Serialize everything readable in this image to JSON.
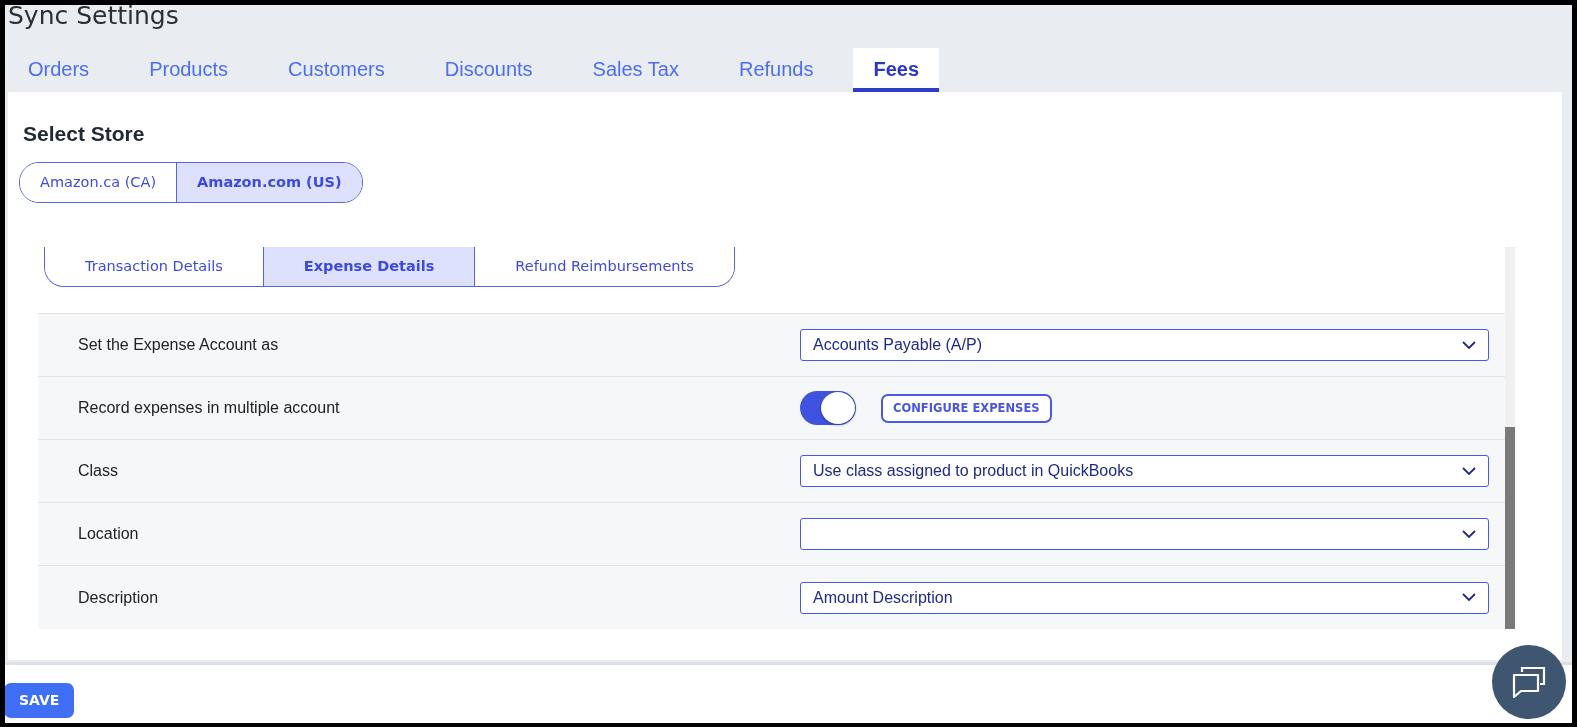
{
  "page_title": "Sync Settings",
  "tabs": [
    {
      "label": "Orders",
      "selected": false
    },
    {
      "label": "Products",
      "selected": false
    },
    {
      "label": "Customers",
      "selected": false
    },
    {
      "label": "Discounts",
      "selected": false
    },
    {
      "label": "Sales Tax",
      "selected": false
    },
    {
      "label": "Refunds",
      "selected": false
    },
    {
      "label": "Fees",
      "selected": true
    }
  ],
  "store_heading": "Select Store",
  "stores": [
    {
      "label": "Amazon.ca (CA)",
      "selected": false
    },
    {
      "label": "Amazon.com (US)",
      "selected": true
    }
  ],
  "subtabs": [
    {
      "label": "Transaction Details",
      "selected": false
    },
    {
      "label": "Expense Details",
      "selected": true
    },
    {
      "label": "Refund Reimbursements",
      "selected": false
    }
  ],
  "settings": [
    {
      "kind": "select",
      "label": "Set the Expense Account as",
      "value": "Accounts Payable (A/P)"
    },
    {
      "kind": "toggle",
      "label": "Record expenses in multiple account",
      "on": true,
      "button": "CONFIGURE EXPENSES"
    },
    {
      "kind": "select",
      "label": "Class",
      "value": "Use class assigned to product in QuickBooks"
    },
    {
      "kind": "select",
      "label": "Location"
    },
    {
      "kind": "select",
      "label": "Description",
      "value": "Amount Description"
    }
  ],
  "save_button": "SAVE"
}
